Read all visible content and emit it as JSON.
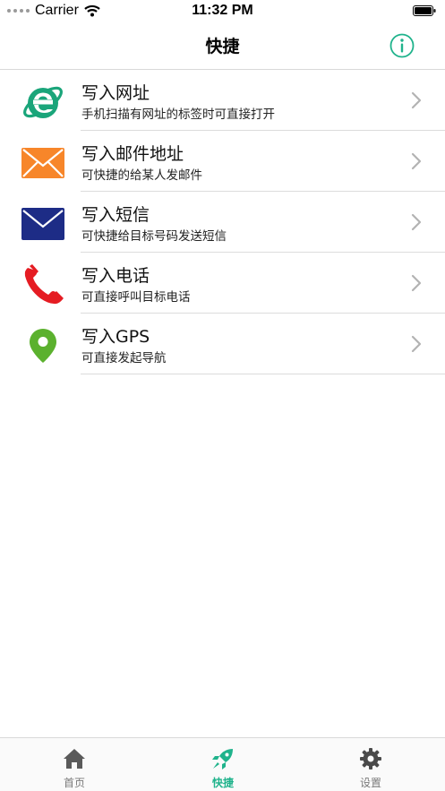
{
  "status_bar": {
    "carrier": "Carrier",
    "time": "11:32 PM"
  },
  "nav": {
    "title": "快捷",
    "info_icon": "info-circle-icon"
  },
  "colors": {
    "accent": "#20b38c",
    "ie_green": "#1aa57a",
    "mail_orange": "#f7862a",
    "sms_navy": "#1d2c86",
    "phone_red": "#e51c23",
    "gps_green": "#5bb12e"
  },
  "list": [
    {
      "title": "写入网址",
      "subtitle": "手机扫描有网址的标签时可直接打开",
      "icon": "ie-browser-icon"
    },
    {
      "title": "写入邮件地址",
      "subtitle": "可快捷的给某人发邮件",
      "icon": "mail-envelope-icon"
    },
    {
      "title": "写入短信",
      "subtitle": "可快捷给目标号码发送短信",
      "icon": "sms-envelope-icon"
    },
    {
      "title": "写入电话",
      "subtitle": "可直接呼叫目标电话",
      "icon": "phone-icon"
    },
    {
      "title": "写入GPS",
      "subtitle": "可直接发起导航",
      "icon": "location-pin-icon"
    }
  ],
  "tabs": [
    {
      "label": "首页",
      "icon": "home-icon"
    },
    {
      "label": "快捷",
      "icon": "rocket-icon",
      "active": true
    },
    {
      "label": "设置",
      "icon": "gear-icon"
    }
  ]
}
